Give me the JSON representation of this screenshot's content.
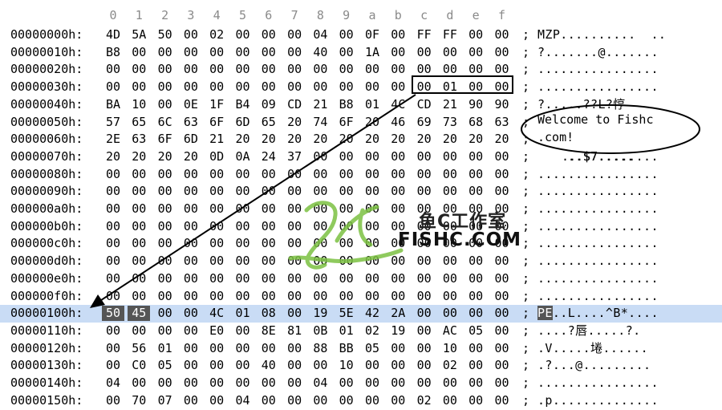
{
  "header": {
    "columns": [
      "0",
      "1",
      "2",
      "3",
      "4",
      "5",
      "6",
      "7",
      "8",
      "9",
      "a",
      "b",
      "c",
      "d",
      "e",
      "f"
    ]
  },
  "rows": [
    {
      "addr": "00000000h:",
      "bytes": [
        "4D",
        "5A",
        "50",
        "00",
        "02",
        "00",
        "00",
        "00",
        "04",
        "00",
        "0F",
        "00",
        "FF",
        "FF",
        "00",
        "00"
      ],
      "ascii": "MZP..........  .."
    },
    {
      "addr": "00000010h:",
      "bytes": [
        "B8",
        "00",
        "00",
        "00",
        "00",
        "00",
        "00",
        "00",
        "40",
        "00",
        "1A",
        "00",
        "00",
        "00",
        "00",
        "00"
      ],
      "ascii": "?.......@......."
    },
    {
      "addr": "00000020h:",
      "bytes": [
        "00",
        "00",
        "00",
        "00",
        "00",
        "00",
        "00",
        "00",
        "00",
        "00",
        "00",
        "00",
        "00",
        "00",
        "00",
        "00"
      ],
      "ascii": "................"
    },
    {
      "addr": "00000030h:",
      "bytes": [
        "00",
        "00",
        "00",
        "00",
        "00",
        "00",
        "00",
        "00",
        "00",
        "00",
        "00",
        "00",
        "00",
        "01",
        "00",
        "00"
      ],
      "ascii": "................"
    },
    {
      "addr": "00000040h:",
      "bytes": [
        "BA",
        "10",
        "00",
        "0E",
        "1F",
        "B4",
        "09",
        "CD",
        "21",
        "B8",
        "01",
        "4C",
        "CD",
        "21",
        "90",
        "90"
      ],
      "ascii": "?.....??L?悙"
    },
    {
      "addr": "00000050h:",
      "bytes": [
        "57",
        "65",
        "6C",
        "63",
        "6F",
        "6D",
        "65",
        "20",
        "74",
        "6F",
        "20",
        "46",
        "69",
        "73",
        "68",
        "63"
      ],
      "ascii": ""
    },
    {
      "addr": "00000060h:",
      "bytes": [
        "2E",
        "63",
        "6F",
        "6D",
        "21",
        "20",
        "20",
        "20",
        "20",
        "20",
        "20",
        "20",
        "20",
        "20",
        "20",
        "20"
      ],
      "ascii": ""
    },
    {
      "addr": "00000070h:",
      "bytes": [
        "20",
        "20",
        "20",
        "20",
        "0D",
        "0A",
        "24",
        "37",
        "00",
        "00",
        "00",
        "00",
        "00",
        "00",
        "00",
        "00"
      ],
      "ascii": "    ..$7........"
    },
    {
      "addr": "00000080h:",
      "bytes": [
        "00",
        "00",
        "00",
        "00",
        "00",
        "00",
        "00",
        "00",
        "00",
        "00",
        "00",
        "00",
        "00",
        "00",
        "00",
        "00"
      ],
      "ascii": "................"
    },
    {
      "addr": "00000090h:",
      "bytes": [
        "00",
        "00",
        "00",
        "00",
        "00",
        "00",
        "00",
        "00",
        "00",
        "00",
        "00",
        "00",
        "00",
        "00",
        "00",
        "00"
      ],
      "ascii": "................"
    },
    {
      "addr": "000000a0h:",
      "bytes": [
        "00",
        "00",
        "00",
        "00",
        "00",
        "00",
        "00",
        "00",
        "00",
        "00",
        "00",
        "00",
        "00",
        "00",
        "00",
        "00"
      ],
      "ascii": "................"
    },
    {
      "addr": "000000b0h:",
      "bytes": [
        "00",
        "00",
        "00",
        "00",
        "00",
        "00",
        "00",
        "00",
        "00",
        "00",
        "00",
        "00",
        "00",
        "00",
        "00",
        "00"
      ],
      "ascii": "................"
    },
    {
      "addr": "000000c0h:",
      "bytes": [
        "00",
        "00",
        "00",
        "00",
        "00",
        "00",
        "00",
        "00",
        "00",
        "00",
        "00",
        "00",
        "00",
        "00",
        "00",
        "00"
      ],
      "ascii": "................"
    },
    {
      "addr": "000000d0h:",
      "bytes": [
        "00",
        "00",
        "00",
        "00",
        "00",
        "00",
        "00",
        "00",
        "00",
        "00",
        "00",
        "00",
        "00",
        "00",
        "00",
        "00"
      ],
      "ascii": "................"
    },
    {
      "addr": "000000e0h:",
      "bytes": [
        "00",
        "00",
        "00",
        "00",
        "00",
        "00",
        "00",
        "00",
        "00",
        "00",
        "00",
        "00",
        "00",
        "00",
        "00",
        "00"
      ],
      "ascii": "................"
    },
    {
      "addr": "000000f0h:",
      "bytes": [
        "00",
        "00",
        "00",
        "00",
        "00",
        "00",
        "00",
        "00",
        "00",
        "00",
        "00",
        "00",
        "00",
        "00",
        "00",
        "00"
      ],
      "ascii": "................"
    },
    {
      "addr": "00000100h:",
      "bytes": [
        "50",
        "45",
        "00",
        "00",
        "4C",
        "01",
        "08",
        "00",
        "19",
        "5E",
        "42",
        "2A",
        "00",
        "00",
        "00",
        "00"
      ],
      "ascii": "PE..L....^B*...."
    },
    {
      "addr": "00000110h:",
      "bytes": [
        "00",
        "00",
        "00",
        "00",
        "E0",
        "00",
        "8E",
        "81",
        "0B",
        "01",
        "02",
        "19",
        "00",
        "AC",
        "05",
        "00"
      ],
      "ascii": "....?唇.....?."
    },
    {
      "addr": "00000120h:",
      "bytes": [
        "00",
        "56",
        "01",
        "00",
        "00",
        "00",
        "00",
        "00",
        "88",
        "BB",
        "05",
        "00",
        "00",
        "10",
        "00",
        "00"
      ],
      "ascii": ".V.....埢......"
    },
    {
      "addr": "00000130h:",
      "bytes": [
        "00",
        "C0",
        "05",
        "00",
        "00",
        "00",
        "40",
        "00",
        "00",
        "10",
        "00",
        "00",
        "00",
        "02",
        "00",
        "00"
      ],
      "ascii": ".?...@........."
    },
    {
      "addr": "00000140h:",
      "bytes": [
        "04",
        "00",
        "00",
        "00",
        "00",
        "00",
        "00",
        "00",
        "04",
        "00",
        "00",
        "00",
        "00",
        "00",
        "00",
        "00"
      ],
      "ascii": "................"
    },
    {
      "addr": "00000150h:",
      "bytes": [
        "00",
        "70",
        "07",
        "00",
        "00",
        "04",
        "00",
        "00",
        "00",
        "00",
        "00",
        "00",
        "02",
        "00",
        "00",
        "00"
      ],
      "ascii": ".p.............."
    }
  ],
  "separator": ";",
  "annotation": {
    "bubble_line1": "Welcome to Fishc",
    "bubble_line2": ".com!",
    "below_bubble": "...$7....."
  },
  "watermark": {
    "chinese": "鱼C工作室",
    "english": "FISHC.COM"
  },
  "colors": {
    "selected_row": "#c9dcf5",
    "byte_highlight": "#555555",
    "watermark_green": "#7cc142"
  },
  "selected_row_index": 16
}
